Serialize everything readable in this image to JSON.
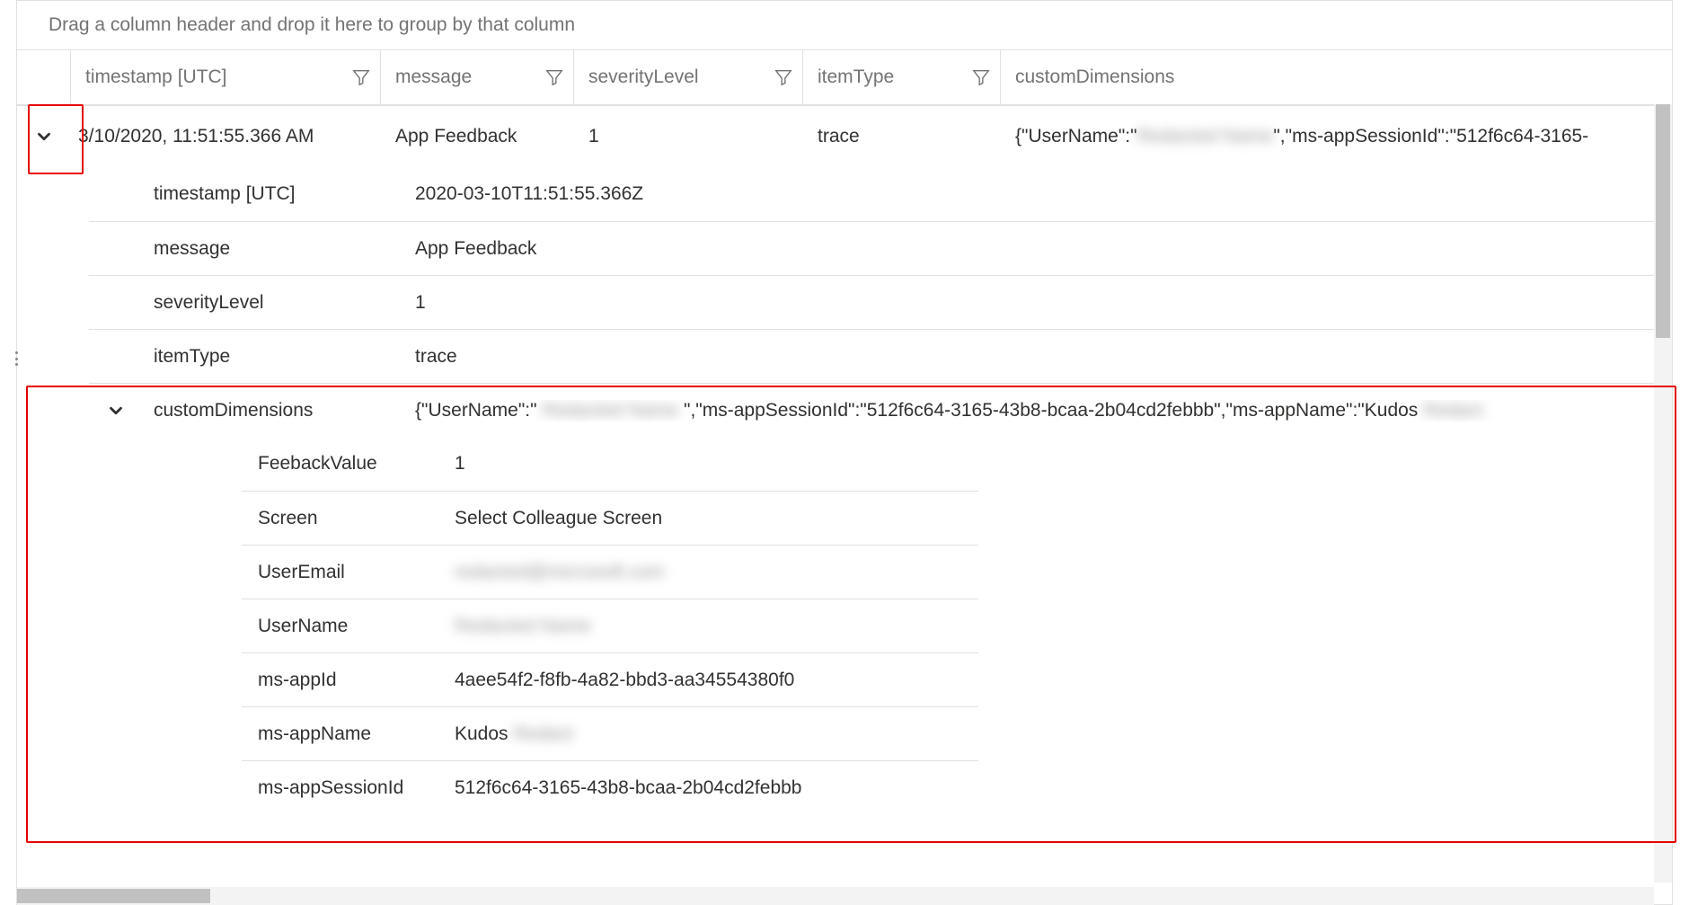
{
  "groupBar": {
    "hint": "Drag a column header and drop it here to group by that column"
  },
  "columns": {
    "timestamp": "timestamp [UTC]",
    "message": "message",
    "severityLevel": "severityLevel",
    "itemType": "itemType",
    "customDimensions": "customDimensions"
  },
  "row": {
    "timestamp": "3/10/2020, 11:51:55.366 AM",
    "message": "App Feedback",
    "severityLevel": "1",
    "itemType": "trace",
    "customDimensions_prefix": "{\"UserName\":\"",
    "customDimensions_blur1": "Redacted Name",
    "customDimensions_suffix": "\",\"ms-appSessionId\":\"512f6c64-3165-"
  },
  "detail": {
    "timestamp_label": "timestamp [UTC]",
    "timestamp_value": "2020-03-10T11:51:55.366Z",
    "message_label": "message",
    "message_value": "App Feedback",
    "severity_label": "severityLevel",
    "severity_value": "1",
    "itemType_label": "itemType",
    "itemType_value": "trace",
    "cd_label": "customDimensions",
    "cd_prefix": "{\"UserName\":\"",
    "cd_blur1": "Redacted Name",
    "cd_mid": "\",\"ms-appSessionId\":\"512f6c64-3165-43b8-bcaa-2b04cd2febbb\",\"ms-appName\":\"Kudos ",
    "cd_blur2": "Redact",
    "cd_items": {
      "feedback_label": "FeebackValue",
      "feedback_value": "1",
      "screen_label": "Screen",
      "screen_value": "Select Colleague Screen",
      "useremail_label": "UserEmail",
      "useremail_value": "redacted@microsoft.com",
      "username_label": "UserName",
      "username_value": "Redacted Name",
      "appid_label": "ms-appId",
      "appid_value": "4aee54f2-f8fb-4a82-bbd3-aa34554380f0",
      "appname_label": "ms-appName",
      "appname_value_prefix": "Kudos ",
      "appname_value_blur": "Redact",
      "appsession_label": "ms-appSessionId",
      "appsession_value": "512f6c64-3165-43b8-bcaa-2b04cd2febbb"
    }
  }
}
